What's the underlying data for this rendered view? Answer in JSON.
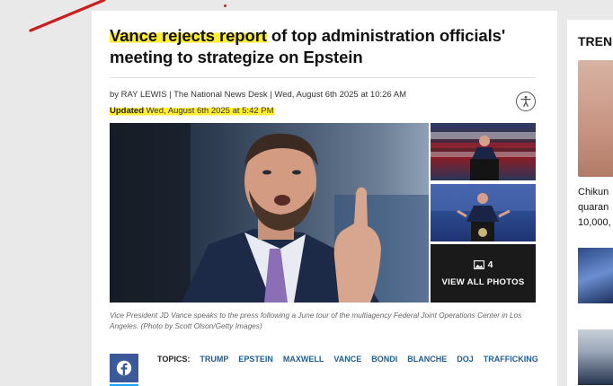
{
  "article": {
    "headline_highlight": "Vance rejects report",
    "headline_rest": " of top administration officials' meeting to strategize on Epstein",
    "byline": "by RAY LEWIS | The National News Desk | Wed, August 6th 2025 at 10:26 AM",
    "updated_label": "Updated",
    "updated_value": " Wed, August 6th 2025 at 5:42 PM",
    "gallery": {
      "photo_count": "4",
      "view_all_label": "VIEW ALL PHOTOS"
    },
    "caption": "Vice President JD Vance speaks to the press following a June tour of the multiagency Federal Joint Operations Center in Los Angeles. (Photo by Scott Olson/Getty Images)",
    "topics_label": "TOPICS:",
    "topics": [
      "TRUMP",
      "EPSTEIN",
      "MAXWELL",
      "VANCE",
      "BONDI",
      "BLANCHE",
      "DOJ",
      "TRAFFICKING"
    ]
  },
  "sidebar": {
    "heading": "TREN",
    "story_lines": [
      "Chikun",
      "quaran",
      "10,000,"
    ]
  },
  "colors": {
    "highlight": "#ffee32",
    "annotation": "#c91f1f",
    "facebook": "#3b5998",
    "topic_link": "#1f5d94"
  },
  "icons": [
    "accessibility-icon",
    "gallery-icon",
    "facebook-icon"
  ]
}
